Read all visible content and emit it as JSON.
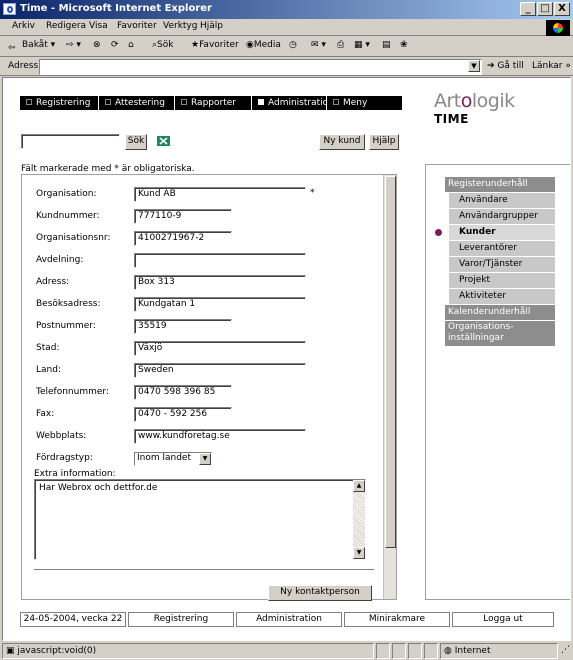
{
  "window": {
    "title": "Time - Microsoft Internet Explorer",
    "btn_min": "_",
    "btn_max": "□",
    "btn_close": "X"
  },
  "menubar": [
    "Arkiv",
    "Redigera",
    "Visa",
    "Favoriter",
    "Verktyg",
    "Hjälp"
  ],
  "toolbar": {
    "back": "Bakåt",
    "search": "Sök",
    "favorites": "Favoriter",
    "media": "Media"
  },
  "address": {
    "label": "Adress",
    "value": "",
    "go": "Gå till",
    "links": "Länkar"
  },
  "brand": {
    "part1": "Art",
    "accent": "o",
    "part2": "logik",
    "product": "TIME",
    "accent_color": "#7a1e5f"
  },
  "nav": {
    "items": [
      "Registrering",
      "Attestering",
      "Rapporter",
      "Administration",
      "Meny"
    ]
  },
  "search": {
    "input_value": "",
    "button": "Sök",
    "new_customer": "Ny kund",
    "help": "Hjälp"
  },
  "form": {
    "required_hint": "Fält markerade med * är obligatoriska.",
    "required_mark": "*",
    "fields": {
      "organisation": {
        "label": "Organisation:",
        "value": "Kund AB"
      },
      "kundnummer": {
        "label": "Kundnummer:",
        "value": "777110-9"
      },
      "orgnr": {
        "label": "Organisationsnr:",
        "value": "4100271967-2"
      },
      "avdelning": {
        "label": "Avdelning:",
        "value": ""
      },
      "adress": {
        "label": "Adress:",
        "value": "Box 313"
      },
      "besoksadress": {
        "label": "Besöksadress:",
        "value": "Kundgatan 1"
      },
      "postnummer": {
        "label": "Postnummer:",
        "value": "35519"
      },
      "stad": {
        "label": "Stad:",
        "value": "Växjö"
      },
      "land": {
        "label": "Land:",
        "value": "Sweden"
      },
      "telefon": {
        "label": "Telefonnummer:",
        "value": "0470 598 396 85"
      },
      "fax": {
        "label": "Fax:",
        "value": "0470 - 592 256"
      },
      "webbplats": {
        "label": "Webbplats:",
        "value": "www.kundforetag.se"
      },
      "fordragstyp": {
        "label": "Fördragstyp:",
        "value": "Inom landet"
      }
    },
    "extra": {
      "label": "Extra information:",
      "value": "Har Webrox och dettfor.de"
    },
    "new_contact_button": "Ny kontaktperson"
  },
  "sidebar": {
    "groups": [
      {
        "label": "Registerunderhåll",
        "children": [
          "Användare",
          "Användargrupper",
          "Kunder",
          "Leverantörer",
          "Varor/Tjänster",
          "Projekt",
          "Aktiviteter"
        ]
      },
      {
        "label": "Kalenderunderhåll",
        "children": []
      },
      {
        "label": "Organisations-inställningar",
        "children": []
      }
    ],
    "active_item": "Kunder"
  },
  "footer": {
    "items": [
      "24-05-2004, vecka 22",
      "Registrering",
      "Administration",
      "Minirakmare",
      "Logga ut"
    ]
  },
  "status": {
    "left": "javascript:void(0)",
    "zone": "Internet"
  }
}
